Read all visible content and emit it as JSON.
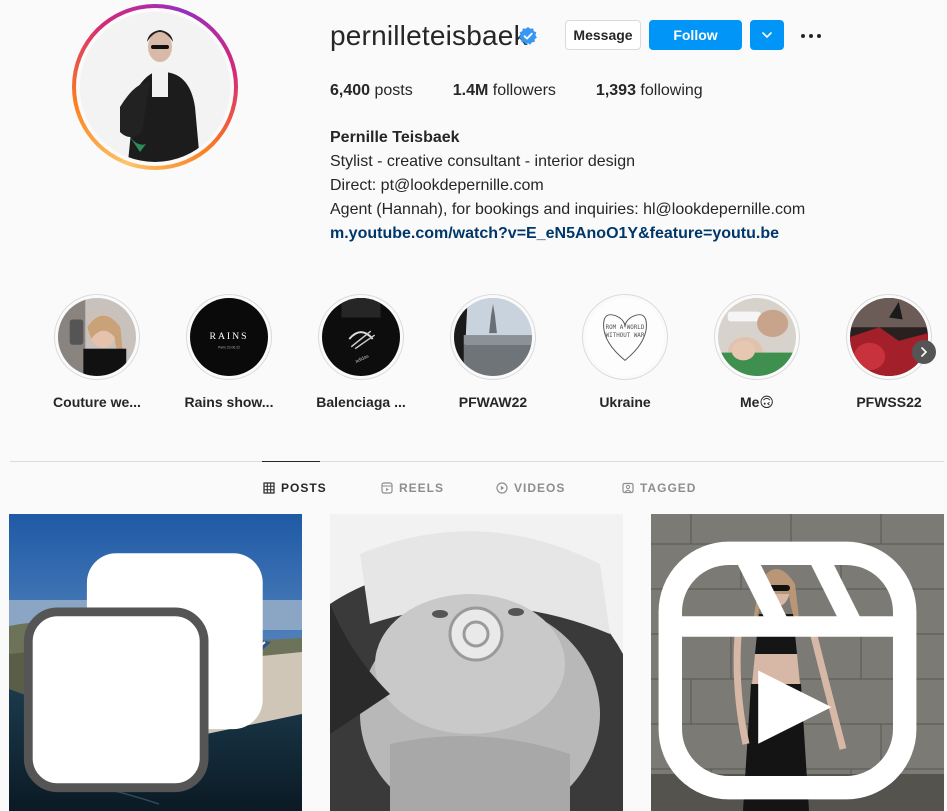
{
  "profile": {
    "username": "pernilleteisbaek",
    "verified_icon": "verified-badge-icon",
    "buttons": {
      "message": "Message",
      "follow": "Follow",
      "caret_icon": "chevron-down-icon",
      "more_icon": "more-options-icon"
    },
    "stats": [
      {
        "value": "6,400",
        "label": "posts"
      },
      {
        "value": "1.4M",
        "label": "followers"
      },
      {
        "value": "1,393",
        "label": "following"
      }
    ],
    "bio": {
      "name": "Pernille Teisbaek",
      "lines": [
        "Stylist - creative consultant - interior design",
        "Direct: pt@lookdepernille.com",
        "Agent (Hannah), for bookings and inquiries: hl@lookdepernille.com"
      ],
      "link": "m.youtube.com/watch?v=E_eN5AnoO1Y&feature=youtu.be"
    }
  },
  "highlights": [
    {
      "label": "Couture we..."
    },
    {
      "label": "Rains show...",
      "image_text": "RAINS",
      "image_subtext": "Paris 23.06.22"
    },
    {
      "label": "Balenciaga ..."
    },
    {
      "label": "PFWAW22"
    },
    {
      "label": "Ukraine",
      "image_text_1": "ROM A WORLD",
      "image_text_2": "WITHOUT WAR"
    },
    {
      "label": "Me🙃"
    },
    {
      "label": "PFWSS22"
    }
  ],
  "highlights_next_icon": "chevron-right-icon",
  "tabs": [
    {
      "label": "POSTS",
      "icon": "grid-icon",
      "active": true
    },
    {
      "label": "REELS",
      "icon": "reels-icon",
      "active": false
    },
    {
      "label": "VIDEOS",
      "icon": "video-icon",
      "active": false
    },
    {
      "label": "TAGGED",
      "icon": "tagged-icon",
      "active": false
    }
  ],
  "posts": [
    {
      "subject": "infinity pool with sun loungers overlooking the sea",
      "badge_icon": "carousel-icon"
    },
    {
      "subject": "black and white baby with pacifier and bucket hat",
      "badge_icon": ""
    },
    {
      "subject": "woman in black outfit against stone wall",
      "badge_icon": "reel-icon"
    }
  ],
  "colors": {
    "follow_blue": "#0095f6",
    "link": "#00376b",
    "text": "#262626",
    "muted": "#8e8e8e",
    "border": "#dbdbdb"
  }
}
